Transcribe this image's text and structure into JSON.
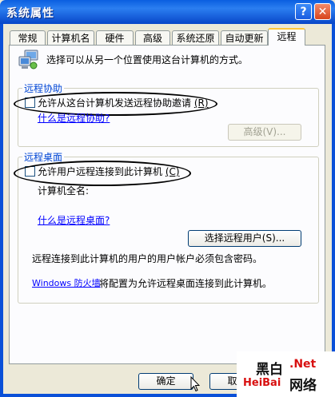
{
  "window": {
    "title": "系统属性",
    "help_label": "?",
    "close_label": "✕"
  },
  "tabs": [
    {
      "label": "常规"
    },
    {
      "label": "计算机名"
    },
    {
      "label": "硬件"
    },
    {
      "label": "高级"
    },
    {
      "label": "系统还原"
    },
    {
      "label": "自动更新"
    },
    {
      "label": "远程"
    }
  ],
  "active_tab": "远程",
  "intro_text": "选择可以从另一个位置使用这台计算机的方式。",
  "remote_assistance": {
    "group_title": "远程协助",
    "checkbox_label": "允许从这台计算机发送远程协助邀请",
    "checkbox_accel": "(R)",
    "checked": false,
    "help_link": "什么是远程协助?",
    "advanced_button": "高级(V)..."
  },
  "remote_desktop": {
    "group_title": "远程桌面",
    "checkbox_label": "允许用户远程连接到此计算机",
    "checkbox_accel": "(C)",
    "checked": false,
    "computer_name_label": "计算机全名:",
    "help_link": "什么是远程桌面?",
    "select_users_button": "选择远程用户(S)...",
    "password_note": "远程连接到此计算机的用户的用户帐户必须包含密码。",
    "firewall_link": "Windows 防火墙",
    "firewall_note": "将配置为允许远程桌面连接到此计算机。"
  },
  "footer": {
    "ok_label": "确定",
    "cancel_label": "取消"
  },
  "watermark": {
    "brand_cn_1": "黑白",
    "brand_net": ".Net",
    "brand_en": "HeiBai",
    "brand_cn_2": "网络"
  }
}
